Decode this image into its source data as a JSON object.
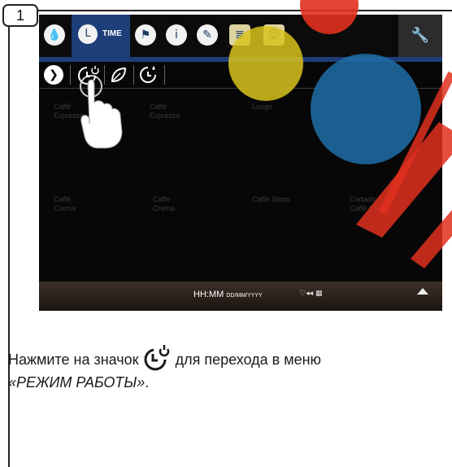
{
  "step_number": "1",
  "device": {
    "top_tabs": {
      "water_icon": "water-drop",
      "time_label": "TIME",
      "flag_icon": "flag",
      "info_icon": "info",
      "edit_icon": "pencil",
      "list_icon": "list",
      "user_icon": "user",
      "settings_icon": "wrench"
    },
    "mode_icons": [
      "arrow-right",
      "power-clock",
      "leaf",
      "drop-clock"
    ],
    "tiles": [
      {
        "line1": "Caffè",
        "line2": "Espresso"
      },
      {
        "line1": "Caffè",
        "line2": "Espresso"
      },
      {
        "line1": "Lungo",
        "line2": ""
      },
      {
        "line1": "Lungo",
        "line2": ""
      },
      {
        "line1": "Caffè",
        "line2": "Crema"
      },
      {
        "line1": "Caffè",
        "line2": "Crema"
      },
      {
        "line1": "Caffè Shots",
        "line2": ""
      },
      {
        "line1": "Cortado",
        "line2": "Caffè Shots"
      }
    ],
    "bottom": {
      "time": "HH:MM",
      "date": "DD/MM/YYYY",
      "status": "♡◂◂ ▦"
    }
  },
  "instruction": {
    "before_icon": "Нажмите на значок",
    "after_icon": " для перехода в меню",
    "menu_name": "«РЕЖИМ РАБОТЫ»",
    "end": "."
  },
  "colors": {
    "tab_blue": "#1d3e78",
    "highlight_yellow": "#d8c21c",
    "highlight_blue": "#1f6fa8",
    "highlight_red": "#e0301e"
  }
}
